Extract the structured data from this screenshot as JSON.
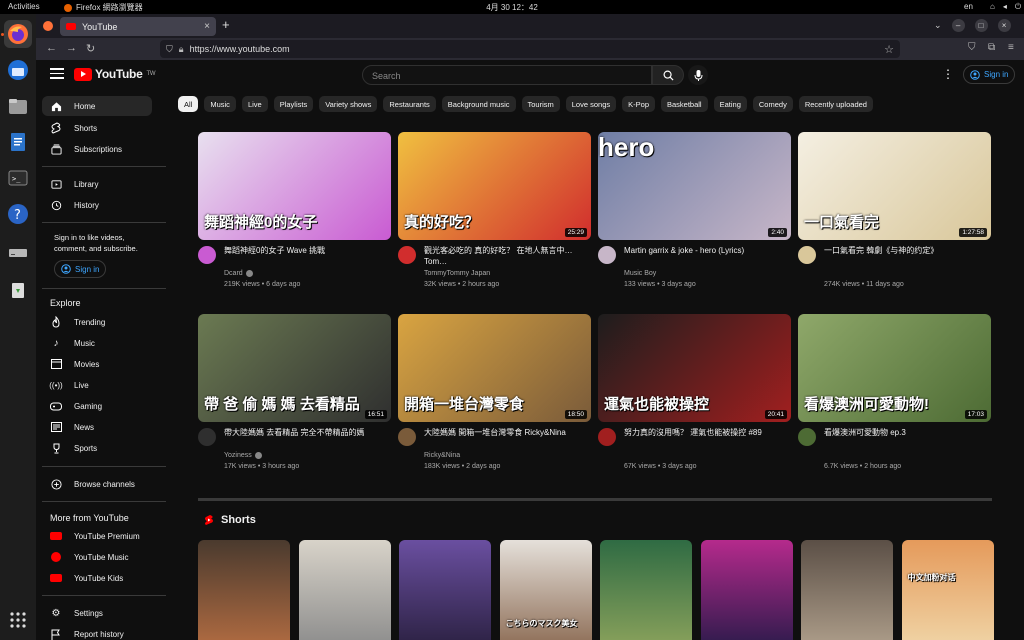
{
  "system": {
    "activities": "Activities",
    "app_name": "Firefox 網路瀏覽器",
    "clock": "4月 30 12：42",
    "lang": "en"
  },
  "browser": {
    "tab_title": "YouTube",
    "url": "https://www.youtube.com"
  },
  "header": {
    "logo_text": "YouTube",
    "logo_sup": "TW",
    "search_placeholder": "Search",
    "signin": "Sign in"
  },
  "sidebar": {
    "main": [
      {
        "label": "Home",
        "icon": "home-icon"
      },
      {
        "label": "Shorts",
        "icon": "shorts-icon"
      },
      {
        "label": "Subscriptions",
        "icon": "subscriptions-icon"
      }
    ],
    "you": [
      {
        "label": "Library",
        "icon": "library-icon"
      },
      {
        "label": "History",
        "icon": "history-icon"
      }
    ],
    "signin_text": "Sign in to like videos, comment, and subscribe.",
    "signin_button": "Sign in",
    "explore_heading": "Explore",
    "explore": [
      {
        "label": "Trending"
      },
      {
        "label": "Music"
      },
      {
        "label": "Movies"
      },
      {
        "label": "Live"
      },
      {
        "label": "Gaming"
      },
      {
        "label": "News"
      },
      {
        "label": "Sports"
      }
    ],
    "browse_channels": "Browse channels",
    "more_heading": "More from YouTube",
    "more": [
      {
        "label": "YouTube Premium"
      },
      {
        "label": "YouTube Music"
      },
      {
        "label": "YouTube Kids"
      }
    ],
    "settings": "Settings",
    "report_history": "Report history"
  },
  "chips": [
    "All",
    "Music",
    "Live",
    "Playlists",
    "Variety shows",
    "Restaurants",
    "Background music",
    "Tourism",
    "Love songs",
    "K-Pop",
    "Basketball",
    "Eating",
    "Comedy",
    "Recently uploaded"
  ],
  "videos": [
    {
      "title": "舞蹈神經0的女子 Wave 挑戰",
      "thumb_text": "舞蹈神經0的女子",
      "channel": "Dcard",
      "verified": true,
      "meta": "219K views • 6 days ago",
      "duration": "",
      "colors": [
        "#e8e0ef",
        "#c95bd2"
      ]
    },
    {
      "title": "觀光客必吃的 真的好吃？ 在地人無言中…Tom…",
      "thumb_text": "真的好吃？",
      "channel": "TommyTommy Japan",
      "verified": false,
      "meta": "32K views • 2 hours ago",
      "duration": "25:29",
      "colors": [
        "#f0c040",
        "#d12d2d"
      ]
    },
    {
      "title": "Martin garrix & joke - hero (Lyrics)",
      "thumb_text": "hero",
      "channel": "Music Boy",
      "verified": false,
      "meta": "133 views • 3 days ago",
      "duration": "2:40",
      "colors": [
        "#6f7ea5",
        "#c7b6c8"
      ]
    },
    {
      "title": "一口氣看完 韓劇《与神的约定》",
      "thumb_text": "一口氣看完",
      "channel": "",
      "verified": false,
      "meta": "274K views • 11 days ago",
      "duration": "1:27:58",
      "colors": [
        "#f4efe2",
        "#d9c79a"
      ]
    },
    {
      "title": "帶大陸媽媽 去看精品 完全不帶精品的媽",
      "thumb_text": "帶 爸 偷 媽 媽 去看精品",
      "channel": "Yoziness",
      "verified": true,
      "meta": "17K views • 3 hours ago",
      "duration": "16:51",
      "colors": [
        "#6b7a52",
        "#2f2f2f"
      ]
    },
    {
      "title": "大陸媽媽 開箱一堆台灣零食 Ricky&Nina",
      "thumb_text": "開箱一堆台灣零食",
      "channel": "Ricky&Nina",
      "verified": false,
      "meta": "183K views • 2 days ago",
      "duration": "18:50",
      "colors": [
        "#d9a441",
        "#7a5b3a"
      ]
    },
    {
      "title": "努力真的沒用嗎？ 運氣也能被操控 #89",
      "thumb_text": "運氣也能被操控",
      "channel": "",
      "verified": false,
      "meta": "67K views • 3 days ago",
      "duration": "20:41",
      "colors": [
        "#1d1d1d",
        "#a11f1f"
      ]
    },
    {
      "title": "看爆澳洲可愛動物 ep.3",
      "thumb_text": "看爆澳洲可愛動物!",
      "channel": "",
      "verified": false,
      "meta": "6.7K views • 2 hours ago",
      "duration": "17:03",
      "colors": [
        "#8fa86a",
        "#4d6b34"
      ]
    }
  ],
  "shorts_heading": "Shorts",
  "shorts": [
    {
      "overlay": "",
      "colors": [
        "#4a3a2e",
        "#b46d42"
      ]
    },
    {
      "overlay": "",
      "colors": [
        "#d8d3c9",
        "#8a8a8a"
      ]
    },
    {
      "overlay": "",
      "colors": [
        "#6a4fa0",
        "#2a2040"
      ]
    },
    {
      "overlay": "こちらのマスク美女",
      "colors": [
        "#e5e0da",
        "#8b6a52"
      ]
    },
    {
      "overlay": "",
      "colors": [
        "#2f6b43",
        "#8ca35c"
      ]
    },
    {
      "overlay": "",
      "colors": [
        "#b52a8c",
        "#2a1a4a"
      ]
    },
    {
      "overlay": "",
      "colors": [
        "#5b4f46",
        "#b0a08c"
      ]
    },
    {
      "overlay": "中文加粉对话",
      "colors": [
        "#e59a5b",
        "#f0d6a8"
      ]
    }
  ],
  "colors": {
    "accent": "#ff0000",
    "link": "#3ea6ff",
    "bg": "#0f0f0f"
  }
}
